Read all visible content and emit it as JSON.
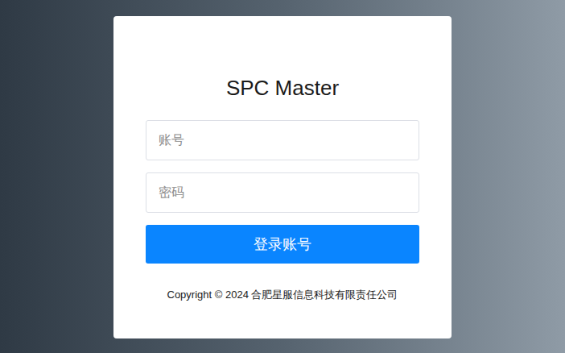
{
  "page": {
    "title": "SPC Master"
  },
  "form": {
    "fields": [
      {
        "placeholder": "账号",
        "kind": "text"
      },
      {
        "placeholder": "密码",
        "kind": "password"
      }
    ],
    "submit": {
      "label": "登录账号"
    }
  },
  "footer": {
    "copyright": "Copyright © 2024 合肥星服信息科技有限责任公司"
  }
}
